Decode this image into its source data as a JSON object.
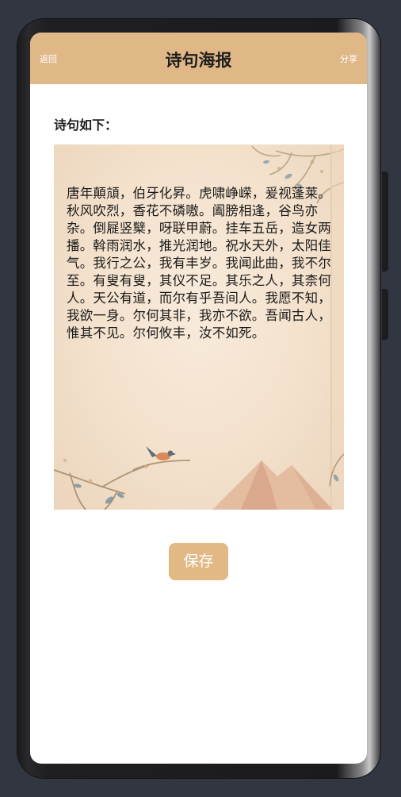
{
  "nav": {
    "back_label": "返回",
    "title": "诗句海报",
    "share_label": "分享"
  },
  "content": {
    "section_label": "诗句如下：",
    "poem": "唐年顛頏，伯牙化昇。虎啸峥嵘，爰视蓬莱。秋风吹烈，香花不磷嗷。阖膀相逢，谷鸟亦杂。倒屣竖櫱，呀联甲蔚。挂车五岳，造女两播。斡雨润水，推光润地。祝水天外，太阳佳气。我行之公，我有丰岁。我闻此曲，我不尔至。有叟有叟，其仪不足。其乐之人，其柰何人。天公有道，而尔有乎吾间人。我愿不知，我欲一身。尔何其非，我亦不欲。吾闻古人，惟其不见。尔何攸丰，汝不如死。"
  },
  "actions": {
    "save_label": "保存"
  },
  "colors": {
    "accent": "#e0b887",
    "background": "#323641",
    "poster_bg": "#f3e1cc"
  },
  "icons": {
    "poster_decoration": "bird-on-branch-illustration"
  }
}
